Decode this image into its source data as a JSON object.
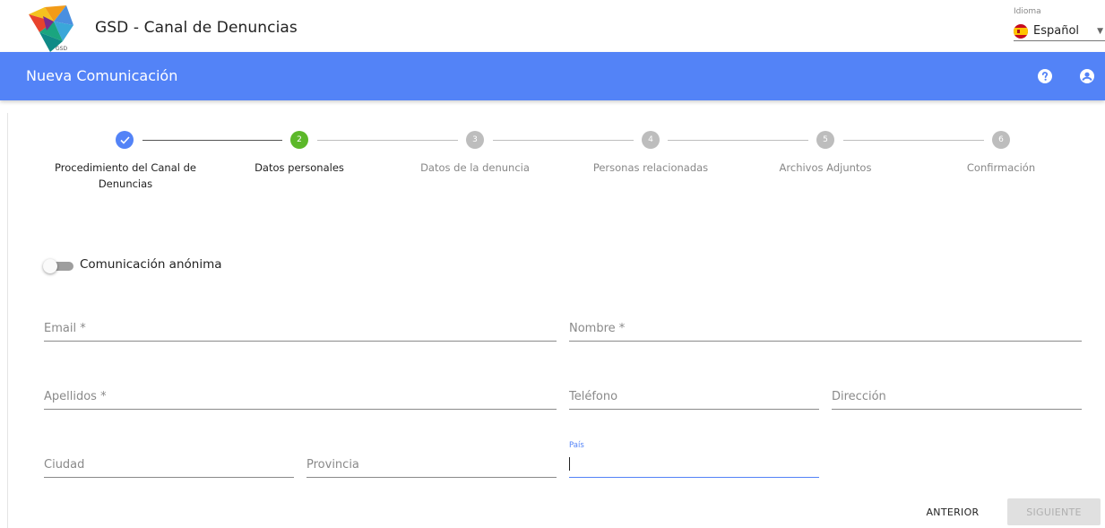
{
  "app": {
    "title": "GSD - Canal de Denuncias",
    "logo_text": "GSD"
  },
  "language": {
    "label": "Idioma",
    "value": "Español",
    "flag_icon": "spain-flag-icon"
  },
  "header": {
    "title": "Nueva Comunicación",
    "help_icon": "help-icon",
    "user_icon": "account-icon",
    "color": "#5383f7"
  },
  "stepper": {
    "current_step": 2,
    "steps": [
      {
        "number": "1",
        "label": "Procedimiento del Canal de Denuncias",
        "state": "completed"
      },
      {
        "number": "2",
        "label": "Datos personales",
        "state": "active"
      },
      {
        "number": "3",
        "label": "Datos de la denuncia",
        "state": "pending"
      },
      {
        "number": "4",
        "label": "Personas relacionadas",
        "state": "pending"
      },
      {
        "number": "5",
        "label": "Archivos Adjuntos",
        "state": "pending"
      },
      {
        "number": "6",
        "label": "Confirmación",
        "state": "pending"
      }
    ],
    "colors": {
      "completed": "#5383f7",
      "active": "#5cb82a",
      "pending": "#bdbdbd"
    }
  },
  "form": {
    "anonymous_toggle": {
      "label": "Comunicación anónima",
      "checked": false
    },
    "fields": {
      "email": {
        "label": "Email *",
        "value": ""
      },
      "nombre": {
        "label": "Nombre *",
        "value": ""
      },
      "apellidos": {
        "label": "Apellidos *",
        "value": ""
      },
      "telefono": {
        "label": "Teléfono",
        "value": ""
      },
      "direccion": {
        "label": "Dirección",
        "value": ""
      },
      "ciudad": {
        "label": "Ciudad",
        "value": ""
      },
      "provincia": {
        "label": "Provincia",
        "value": ""
      },
      "pais": {
        "label": "País",
        "value": "",
        "focused": true
      }
    }
  },
  "actions": {
    "previous": "ANTERIOR",
    "next": "SIGUIENTE",
    "next_disabled": true
  }
}
